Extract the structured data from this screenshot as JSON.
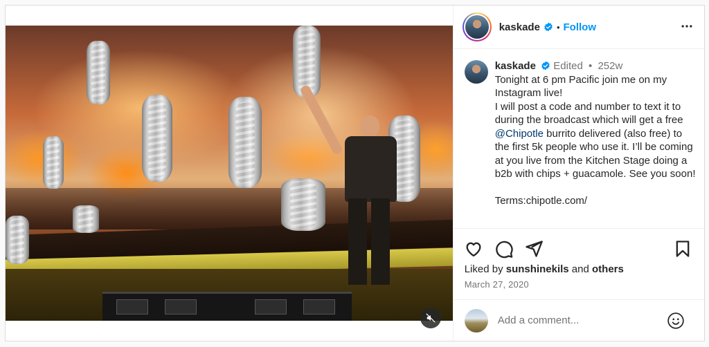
{
  "post": {
    "author": "kaskade",
    "follow_label": "Follow",
    "header_separator": "•",
    "verified": true
  },
  "caption": {
    "author": "kaskade",
    "edited_label": "Edited",
    "separator": "•",
    "age": "252w",
    "text_before_mention": "Tonight at 6 pm Pacific join me on my Instagram live!\nI will post a code and number to text it to during the broadcast which will get a free ",
    "mention": "@Chipotle",
    "text_after_mention": " burrito delivered (also free) to the first 5k people who use it. I’ll be coming at you live from the Kitchen Stage doing a b2b with chips + guacamole. See you soon!\n\nTerms:chipotle.com/"
  },
  "engagement": {
    "liked_by_prefix": "Liked by ",
    "liked_by_user": "sunshinekils",
    "liked_by_joiner": " and ",
    "liked_by_others": "others",
    "date": "March 27, 2020"
  },
  "comment": {
    "placeholder": "Add a comment..."
  },
  "icons": {
    "verified": "verified-badge-icon",
    "more": "more-options-icon",
    "like": "heart-icon",
    "comment": "comment-icon",
    "share": "share-icon",
    "save": "bookmark-icon",
    "emoji": "emoji-icon",
    "mute": "muted-speaker-icon"
  },
  "colors": {
    "accent_blue": "#0095f6",
    "verified_blue": "#0095f6",
    "mention_blue": "#00376b",
    "secondary_text": "#737373",
    "border": "#dbdbdb"
  }
}
